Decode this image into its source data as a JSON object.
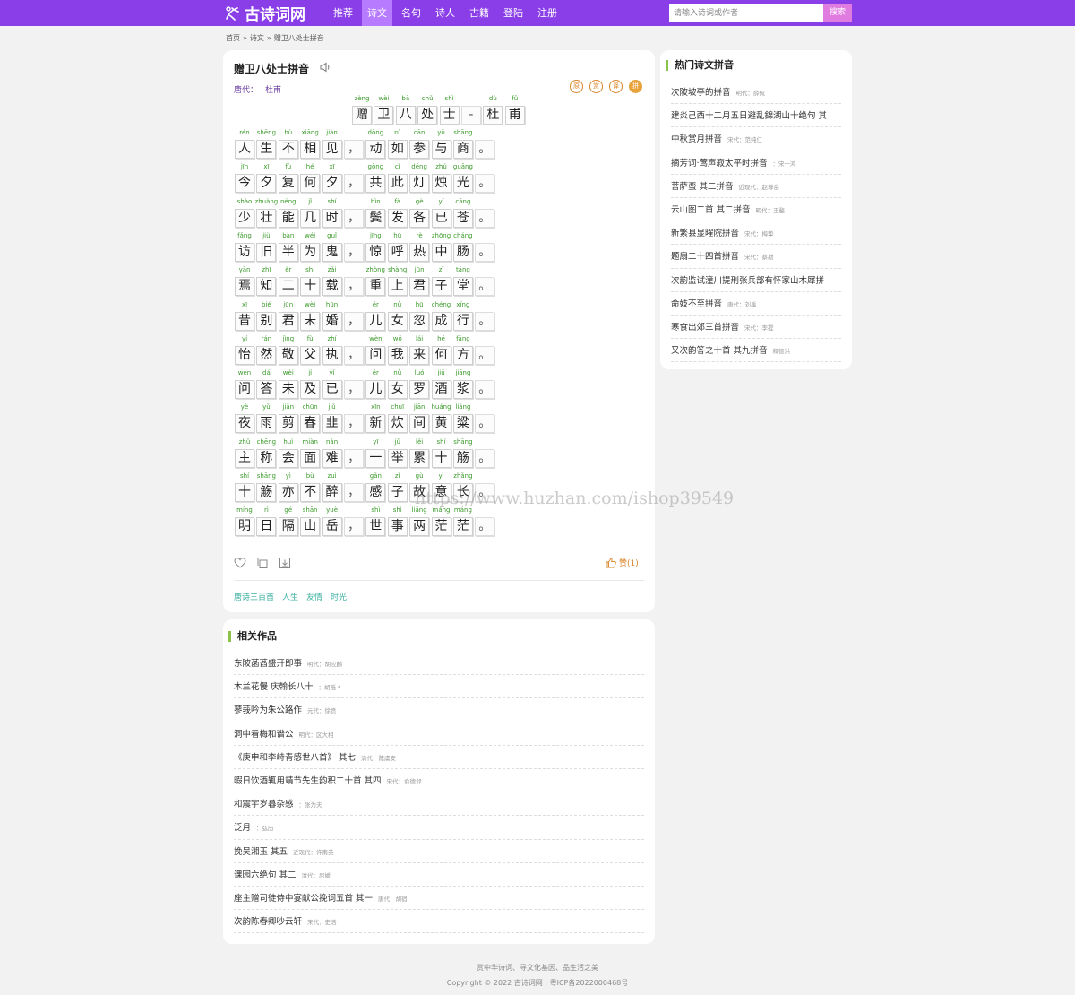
{
  "header": {
    "logo_text": "古诗词网",
    "nav": [
      {
        "label": "推荐",
        "active": false
      },
      {
        "label": "诗文",
        "active": true
      },
      {
        "label": "名句",
        "active": false
      },
      {
        "label": "诗人",
        "active": false
      },
      {
        "label": "古籍",
        "active": false
      },
      {
        "label": "登陆",
        "active": false
      },
      {
        "label": "注册",
        "active": false
      }
    ],
    "search_placeholder": "请输入诗词或作者",
    "search_button": "搜索",
    "accent_color": "#8a3ee8"
  },
  "breadcrumb": [
    "首页",
    "»",
    "诗文",
    "»",
    "赠卫八处士拼音"
  ],
  "poem": {
    "title": "赠卫八处士拼音",
    "dynasty": "唐代：",
    "author": "杜甫",
    "badges": [
      "原",
      "赏",
      "译",
      "拼"
    ],
    "heading": [
      {
        "c": "赠",
        "p": "zèng"
      },
      {
        "c": "卫",
        "p": "wèi"
      },
      {
        "c": "八",
        "p": "bā"
      },
      {
        "c": "处",
        "p": "chǔ"
      },
      {
        "c": "士",
        "p": "shì"
      },
      {
        "c": "-",
        "p": ""
      },
      {
        "c": "杜",
        "p": "dù"
      },
      {
        "c": "甫",
        "p": "fǔ"
      }
    ],
    "lines": [
      {
        "a": [
          [
            "人",
            "rén"
          ],
          [
            "生",
            "shēng"
          ],
          [
            "不",
            "bù"
          ],
          [
            "相",
            "xiāng"
          ],
          [
            "见",
            "jiàn"
          ]
        ],
        "b": [
          [
            "动",
            "dòng"
          ],
          [
            "如",
            "rú"
          ],
          [
            "参",
            "cān"
          ],
          [
            "与",
            "yǔ"
          ],
          [
            "商",
            "shāng"
          ]
        ]
      },
      {
        "a": [
          [
            "今",
            "jīn"
          ],
          [
            "夕",
            "xī"
          ],
          [
            "复",
            "fù"
          ],
          [
            "何",
            "hé"
          ],
          [
            "夕",
            "xī"
          ]
        ],
        "b": [
          [
            "共",
            "gòng"
          ],
          [
            "此",
            "cǐ"
          ],
          [
            "灯",
            "dēng"
          ],
          [
            "烛",
            "zhú"
          ],
          [
            "光",
            "guāng"
          ]
        ]
      },
      {
        "a": [
          [
            "少",
            "shào"
          ],
          [
            "壮",
            "zhuàng"
          ],
          [
            "能",
            "néng"
          ],
          [
            "几",
            "jǐ"
          ],
          [
            "时",
            "shí"
          ]
        ],
        "b": [
          [
            "鬓",
            "bìn"
          ],
          [
            "发",
            "fà"
          ],
          [
            "各",
            "gè"
          ],
          [
            "已",
            "yǐ"
          ],
          [
            "苍",
            "cāng"
          ]
        ]
      },
      {
        "a": [
          [
            "访",
            "fǎng"
          ],
          [
            "旧",
            "jiù"
          ],
          [
            "半",
            "bàn"
          ],
          [
            "为",
            "wéi"
          ],
          [
            "鬼",
            "guǐ"
          ]
        ],
        "b": [
          [
            "惊",
            "jīng"
          ],
          [
            "呼",
            "hū"
          ],
          [
            "热",
            "rè"
          ],
          [
            "中",
            "zhōng"
          ],
          [
            "肠",
            "cháng"
          ]
        ]
      },
      {
        "a": [
          [
            "焉",
            "yān"
          ],
          [
            "知",
            "zhī"
          ],
          [
            "二",
            "èr"
          ],
          [
            "十",
            "shí"
          ],
          [
            "载",
            "zǎi"
          ]
        ],
        "b": [
          [
            "重",
            "zhòng"
          ],
          [
            "上",
            "shàng"
          ],
          [
            "君",
            "jūn"
          ],
          [
            "子",
            "zǐ"
          ],
          [
            "堂",
            "táng"
          ]
        ]
      },
      {
        "a": [
          [
            "昔",
            "xī"
          ],
          [
            "别",
            "bié"
          ],
          [
            "君",
            "jūn"
          ],
          [
            "未",
            "wèi"
          ],
          [
            "婚",
            "hūn"
          ]
        ],
        "b": [
          [
            "儿",
            "ér"
          ],
          [
            "女",
            "nǚ"
          ],
          [
            "忽",
            "hū"
          ],
          [
            "成",
            "chéng"
          ],
          [
            "行",
            "xíng"
          ]
        ]
      },
      {
        "a": [
          [
            "怡",
            "yí"
          ],
          [
            "然",
            "rán"
          ],
          [
            "敬",
            "jìng"
          ],
          [
            "父",
            "fù"
          ],
          [
            "执",
            "zhí"
          ]
        ],
        "b": [
          [
            "问",
            "wèn"
          ],
          [
            "我",
            "wǒ"
          ],
          [
            "来",
            "lái"
          ],
          [
            "何",
            "hé"
          ],
          [
            "方",
            "fāng"
          ]
        ]
      },
      {
        "a": [
          [
            "问",
            "wèn"
          ],
          [
            "答",
            "dá"
          ],
          [
            "未",
            "wèi"
          ],
          [
            "及",
            "jí"
          ],
          [
            "已",
            "yǐ"
          ]
        ],
        "b": [
          [
            "儿",
            "ér"
          ],
          [
            "女",
            "nǚ"
          ],
          [
            "罗",
            "luó"
          ],
          [
            "酒",
            "jiǔ"
          ],
          [
            "浆",
            "jiāng"
          ]
        ]
      },
      {
        "a": [
          [
            "夜",
            "yè"
          ],
          [
            "雨",
            "yǔ"
          ],
          [
            "剪",
            "jiǎn"
          ],
          [
            "春",
            "chūn"
          ],
          [
            "韭",
            "jiǔ"
          ]
        ],
        "b": [
          [
            "新",
            "xīn"
          ],
          [
            "炊",
            "chuī"
          ],
          [
            "间",
            "jiān"
          ],
          [
            "黄",
            "huáng"
          ],
          [
            "粱",
            "liáng"
          ]
        ]
      },
      {
        "a": [
          [
            "主",
            "zhǔ"
          ],
          [
            "称",
            "chēng"
          ],
          [
            "会",
            "huì"
          ],
          [
            "面",
            "miàn"
          ],
          [
            "难",
            "nán"
          ]
        ],
        "b": [
          [
            "一",
            "yī"
          ],
          [
            "举",
            "jǔ"
          ],
          [
            "累",
            "lěi"
          ],
          [
            "十",
            "shí"
          ],
          [
            "觞",
            "shāng"
          ]
        ]
      },
      {
        "a": [
          [
            "十",
            "shí"
          ],
          [
            "觞",
            "shāng"
          ],
          [
            "亦",
            "yì"
          ],
          [
            "不",
            "bù"
          ],
          [
            "醉",
            "zuì"
          ]
        ],
        "b": [
          [
            "感",
            "gǎn"
          ],
          [
            "子",
            "zǐ"
          ],
          [
            "故",
            "gù"
          ],
          [
            "意",
            "yì"
          ],
          [
            "长",
            "zhǎng"
          ]
        ]
      },
      {
        "a": [
          [
            "明",
            "míng"
          ],
          [
            "日",
            "rì"
          ],
          [
            "隔",
            "gé"
          ],
          [
            "山",
            "shān"
          ],
          [
            "岳",
            "yuè"
          ]
        ],
        "b": [
          [
            "世",
            "shì"
          ],
          [
            "事",
            "shì"
          ],
          [
            "两",
            "liǎng"
          ],
          [
            "茫",
            "máng"
          ],
          [
            "茫",
            "máng"
          ]
        ]
      }
    ],
    "comma": "，",
    "period": "。",
    "like_label": "赞(1)",
    "tags": [
      "唐诗三百首",
      "人生",
      "友情",
      "时光"
    ]
  },
  "hot": {
    "title": "热门诗文拼音",
    "items": [
      {
        "name": "次陂坡亭的拼音",
        "meta": "明代：薛侃"
      },
      {
        "name": "建炎己酉十二月五日避乱錦湖山十绝句 其",
        "meta": ""
      },
      {
        "name": "中秋赏月拼音",
        "meta": "宋代：范纯仁"
      },
      {
        "name": "摘芳词·莺声寂太平时拼音",
        "meta": "：宋一鸿"
      },
      {
        "name": "菩萨蛮 其二拼音",
        "meta": "近现代：赵尊岳"
      },
      {
        "name": "云山图二首 其二拼音",
        "meta": "明代：王鏊"
      },
      {
        "name": "新繁县显曜院拼音",
        "meta": "宋代：梅挚"
      },
      {
        "name": "题扇二十四首拼音",
        "meta": "宋代：蔡勘"
      },
      {
        "name": "次韵监试潼川提刑张兵部有怀家山木犀拼",
        "meta": ""
      },
      {
        "name": "命妓不至拼音",
        "meta": "唐代：刘禹"
      },
      {
        "name": "寒食出郊三首拼音",
        "meta": "宋代：李提"
      },
      {
        "name": "又次韵答之十首 其九拼音",
        "meta": "释德洪"
      }
    ]
  },
  "related": {
    "title": "相关作品",
    "items": [
      {
        "name": "东陂菡萏盛开即事",
        "meta": "明代：胡应麟"
      },
      {
        "name": "木兰花慢 庆翰长八十",
        "meta": "：胡祗 *"
      },
      {
        "name": "蓼莪吟为朱公路作",
        "meta": "元代：徐贲"
      },
      {
        "name": "洞中看梅和谱公",
        "meta": "明代：区大相"
      },
      {
        "name": "《庚申和李峙青感世八首》 其七",
        "meta": "清代：陈虞安"
      },
      {
        "name": "暇日饮酒辄用靖节先生韵积二十首 其四",
        "meta": "宋代：俞德邻"
      },
      {
        "name": "和震宇岁暮杂感",
        "meta": "：张为夫"
      },
      {
        "name": "泛月",
        "meta": "：弘历"
      },
      {
        "name": "挽吴湘玉 其五",
        "meta": "近现代：许南英"
      },
      {
        "name": "课园六绝句 其二",
        "meta": "清代：屈媛"
      },
      {
        "name": "座主赠司徒侍中宴献公挽词五首 其一",
        "meta": "唐代：胡宿"
      },
      {
        "name": "次韵陈春卿吵云轩",
        "meta": "宋代：史浩"
      }
    ]
  },
  "footer": {
    "slogan": "赏中华诗词、寻文化基因、品生活之美",
    "copyright": "Copyright © 2022 古诗词网 | 粤ICP备2022000468号"
  },
  "watermark": "https://www.huzhan.com/ishop39549"
}
